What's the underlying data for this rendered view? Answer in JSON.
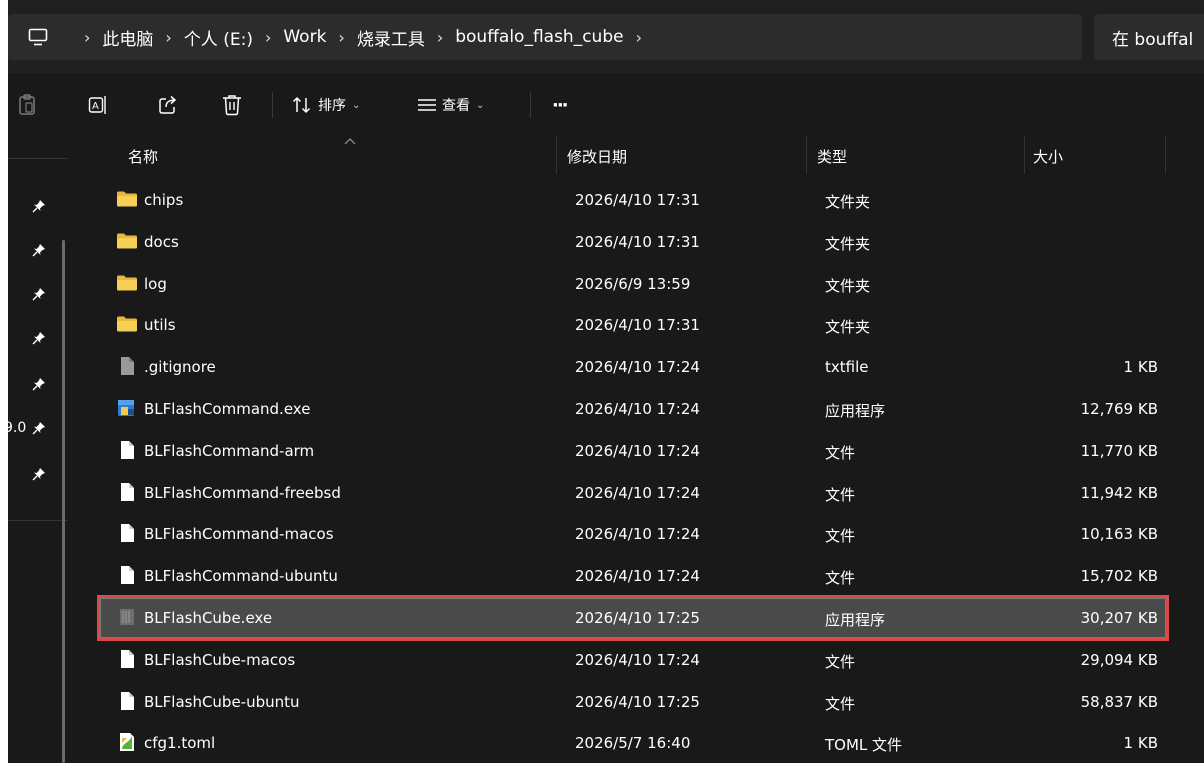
{
  "address_bar": {
    "icon": "computer-icon",
    "crumbs": [
      "此电脑",
      "个人 (E:)",
      "Work",
      "烧录工具",
      "bouffalo_flash_cube"
    ],
    "separator": "›",
    "search_placeholder": "在 bouffal"
  },
  "toolbar": {
    "buttons": [
      {
        "icon": "paste-icon"
      },
      {
        "icon": "rename-icon"
      },
      {
        "icon": "share-icon"
      },
      {
        "icon": "delete-icon"
      }
    ],
    "sort_label": "排序",
    "view_label": "查看",
    "more_label": "···"
  },
  "nav_pane": {
    "partial_text": "9.0"
  },
  "columns": {
    "name": "名称",
    "date": "修改日期",
    "type": "类型",
    "size": "大小"
  },
  "files": [
    {
      "name": "chips",
      "date": "2026/4/10 17:31",
      "type": "文件夹",
      "size": "",
      "icon": "folder-icon"
    },
    {
      "name": "docs",
      "date": "2026/4/10 17:31",
      "type": "文件夹",
      "size": "",
      "icon": "folder-icon"
    },
    {
      "name": "log",
      "date": "2026/6/9 13:59",
      "type": "文件夹",
      "size": "",
      "icon": "folder-icon"
    },
    {
      "name": "utils",
      "date": "2026/4/10 17:31",
      "type": "文件夹",
      "size": "",
      "icon": "folder-icon"
    },
    {
      "name": ".gitignore",
      "date": "2026/4/10 17:24",
      "type": "txtfile",
      "size": "1 KB",
      "icon": "text-file-icon"
    },
    {
      "name": "BLFlashCommand.exe",
      "date": "2026/4/10 17:24",
      "type": "应用程序",
      "size": "12,769 KB",
      "icon": "exe-icon"
    },
    {
      "name": "BLFlashCommand-arm",
      "date": "2026/4/10 17:24",
      "type": "文件",
      "size": "11,770 KB",
      "icon": "file-icon"
    },
    {
      "name": "BLFlashCommand-freebsd",
      "date": "2026/4/10 17:24",
      "type": "文件",
      "size": "11,942 KB",
      "icon": "file-icon"
    },
    {
      "name": "BLFlashCommand-macos",
      "date": "2026/4/10 17:24",
      "type": "文件",
      "size": "10,163 KB",
      "icon": "file-icon"
    },
    {
      "name": "BLFlashCommand-ubuntu",
      "date": "2026/4/10 17:24",
      "type": "文件",
      "size": "15,702 KB",
      "icon": "file-icon"
    },
    {
      "name": "BLFlashCube.exe",
      "date": "2026/4/10 17:25",
      "type": "应用程序",
      "size": "30,207 KB",
      "icon": "app-icon",
      "selected": true
    },
    {
      "name": "BLFlashCube-macos",
      "date": "2026/4/10 17:24",
      "type": "文件",
      "size": "29,094 KB",
      "icon": "file-icon"
    },
    {
      "name": "BLFlashCube-ubuntu",
      "date": "2026/4/10 17:25",
      "type": "文件",
      "size": "58,837 KB",
      "icon": "file-icon"
    },
    {
      "name": "cfg1.toml",
      "date": "2026/5/7 16:40",
      "type": "TOML 文件",
      "size": "1 KB",
      "icon": "toml-file-icon"
    }
  ],
  "colors": {
    "background": "#191919",
    "folder": "#f2c94c",
    "selection_border": "#d94a4a"
  }
}
